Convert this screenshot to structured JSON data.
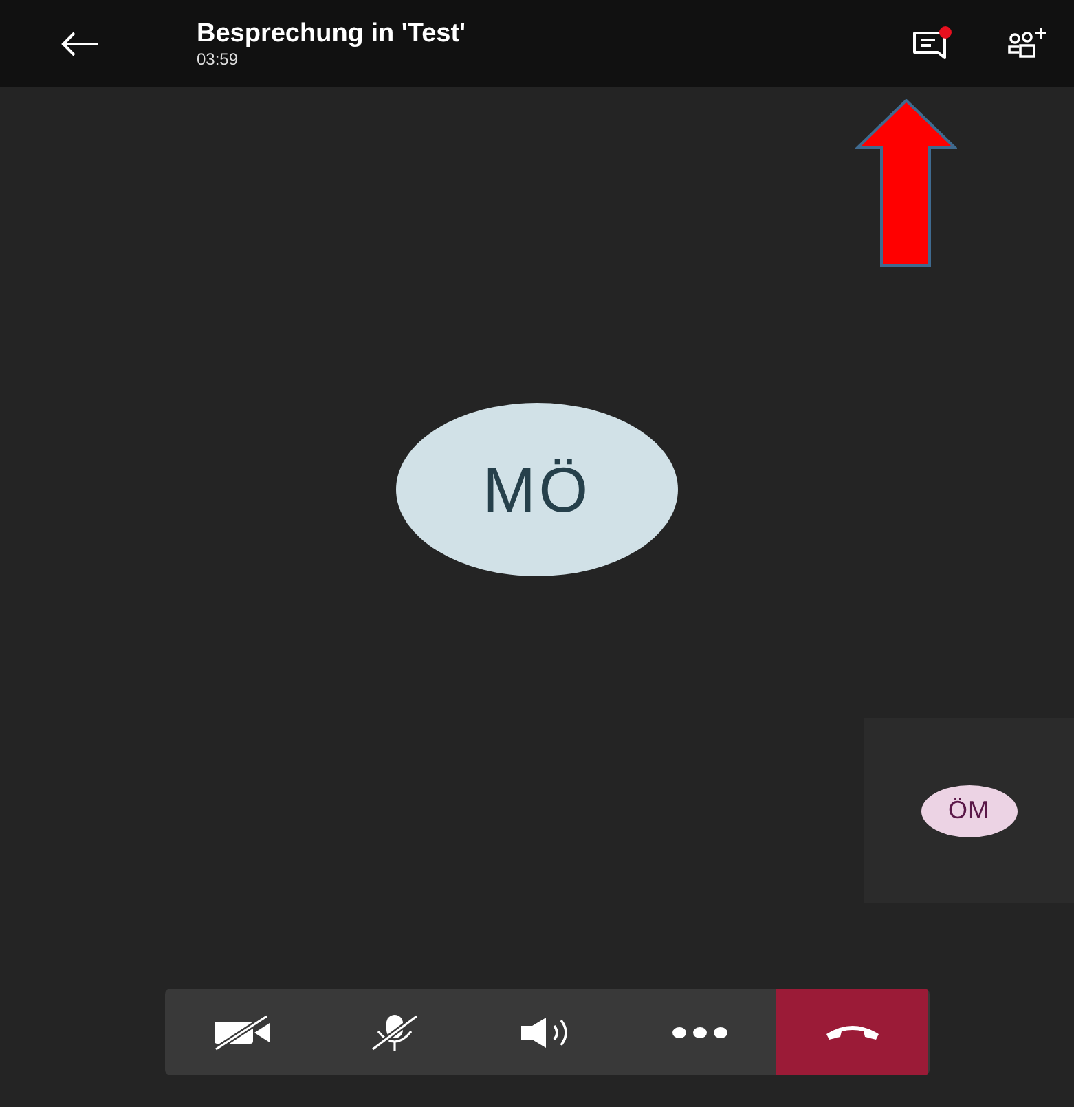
{
  "header": {
    "title": "Besprechung in 'Test'",
    "duration": "03:59",
    "chat_unread": true
  },
  "main_participant": {
    "initials": "MÖ"
  },
  "self_view": {
    "initials": "ÖM"
  },
  "annotation": {
    "kind": "arrow"
  },
  "controls": [
    {
      "kind": "video-off"
    },
    {
      "kind": "mic-off"
    },
    {
      "kind": "speaker"
    },
    {
      "kind": "more"
    },
    {
      "kind": "hangup"
    }
  ]
}
